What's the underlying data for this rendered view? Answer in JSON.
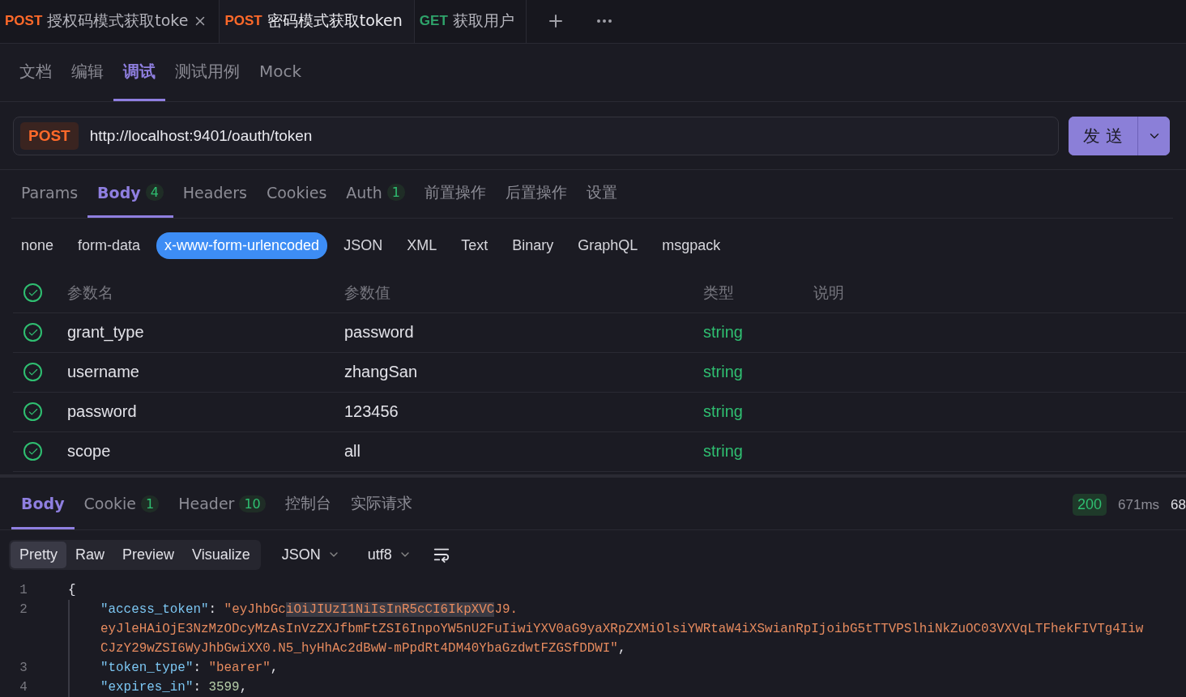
{
  "request_tabs": [
    {
      "method": "POST",
      "title": "授权码模式获取toke",
      "selected": false,
      "closable": true
    },
    {
      "method": "POST",
      "title": "密码模式获取token",
      "selected": true,
      "closable": false
    },
    {
      "method": "GET",
      "title": "获取用户",
      "selected": false,
      "closable": false
    }
  ],
  "view_tabs": [
    {
      "label": "文档",
      "selected": false
    },
    {
      "label": "编辑",
      "selected": false
    },
    {
      "label": "调试",
      "selected": true
    },
    {
      "label": "测试用例",
      "selected": false
    },
    {
      "label": "Mock",
      "selected": false
    }
  ],
  "url_bar": {
    "method": "POST",
    "url": "http://localhost:9401/oauth/token",
    "send_label": "发 送"
  },
  "request_sections": [
    {
      "label": "Params",
      "selected": false
    },
    {
      "label": "Body",
      "count": "4",
      "selected": true
    },
    {
      "label": "Headers",
      "selected": false
    },
    {
      "label": "Cookies",
      "selected": false
    },
    {
      "label": "Auth",
      "count": "1",
      "selected": false
    },
    {
      "label": "前置操作",
      "selected": false
    },
    {
      "label": "后置操作",
      "selected": false
    },
    {
      "label": "设置",
      "selected": false
    }
  ],
  "body_types": [
    {
      "label": "none",
      "selected": false
    },
    {
      "label": "form-data",
      "selected": false
    },
    {
      "label": "x-www-form-urlencoded",
      "selected": true
    },
    {
      "label": "JSON",
      "selected": false
    },
    {
      "label": "XML",
      "selected": false
    },
    {
      "label": "Text",
      "selected": false
    },
    {
      "label": "Binary",
      "selected": false
    },
    {
      "label": "GraphQL",
      "selected": false
    },
    {
      "label": "msgpack",
      "selected": false
    }
  ],
  "params_table": {
    "all_checked": true,
    "columns": [
      "参数名",
      "参数值",
      "类型",
      "说明"
    ],
    "rows": [
      {
        "checked": true,
        "name": "grant_type",
        "value": "password",
        "type": "string"
      },
      {
        "checked": true,
        "name": "username",
        "value": "zhangSan",
        "type": "string"
      },
      {
        "checked": true,
        "name": "password",
        "value": "123456",
        "type": "string"
      },
      {
        "checked": true,
        "name": "scope",
        "value": "all",
        "type": "string"
      }
    ]
  },
  "response_tabs": [
    {
      "label": "Body",
      "selected": true
    },
    {
      "label": "Cookie",
      "count": "1",
      "selected": false
    },
    {
      "label": "Header",
      "count": "10",
      "selected": false
    },
    {
      "label": "控制台",
      "selected": false
    },
    {
      "label": "实际请求",
      "selected": false
    }
  ],
  "response_status": {
    "code": "200",
    "time": "671ms",
    "size": "68"
  },
  "view_modes": [
    {
      "label": "Pretty",
      "selected": true
    },
    {
      "label": "Raw",
      "selected": false
    },
    {
      "label": "Preview",
      "selected": false
    },
    {
      "label": "Visualize",
      "selected": false
    }
  ],
  "format_select": "JSON",
  "encoding_select": "utf8",
  "code_lines": [
    {
      "number": "1",
      "indent": false,
      "segments": [
        {
          "kind": "punct",
          "text": "{"
        }
      ]
    },
    {
      "number": "2",
      "indent": true,
      "segments": [
        {
          "kind": "key",
          "text": "\"access_token\""
        },
        {
          "kind": "punct",
          "text": ": "
        },
        {
          "kind": "string",
          "text": "\"eyJhbGc"
        },
        {
          "kind": "highlight",
          "text": "iOiJIUzI1NiIsInR5cCI6IkpXVC"
        },
        {
          "kind": "string",
          "text": "J9."
        }
      ]
    },
    {
      "indent": true,
      "segments": [
        {
          "kind": "string",
          "text": "eyJleHAiOjE3NzMzODcyMzAsInVzZXJfbmFtZSI6InpoYW5nU2FuIiwiYXV0aG9yaXRpZXMiOlsiYWRtaW4iXSwianRpIjoibG5tTTVPSlhiNkZuOC03VXVqLTFhekFIVTg4Iiw"
        }
      ]
    },
    {
      "indent": true,
      "segments": [
        {
          "kind": "string",
          "text": "CJzY29wZSI6WyJhbGwiXX0.N5_hyHhAc2dBwW-mPpdRt4DM40YbaGzdwtFZGSfDDWI\""
        },
        {
          "kind": "punct",
          "text": ","
        }
      ]
    },
    {
      "number": "3",
      "indent": true,
      "segments": [
        {
          "kind": "key",
          "text": "\"token_type\""
        },
        {
          "kind": "punct",
          "text": ": "
        },
        {
          "kind": "string",
          "text": "\"bearer\""
        },
        {
          "kind": "punct",
          "text": ","
        }
      ]
    },
    {
      "number": "4",
      "indent": true,
      "segments": [
        {
          "kind": "key",
          "text": "\"expires_in\""
        },
        {
          "kind": "punct",
          "text": ": "
        },
        {
          "kind": "number",
          "text": "3599"
        },
        {
          "kind": "punct",
          "text": ","
        }
      ]
    }
  ]
}
